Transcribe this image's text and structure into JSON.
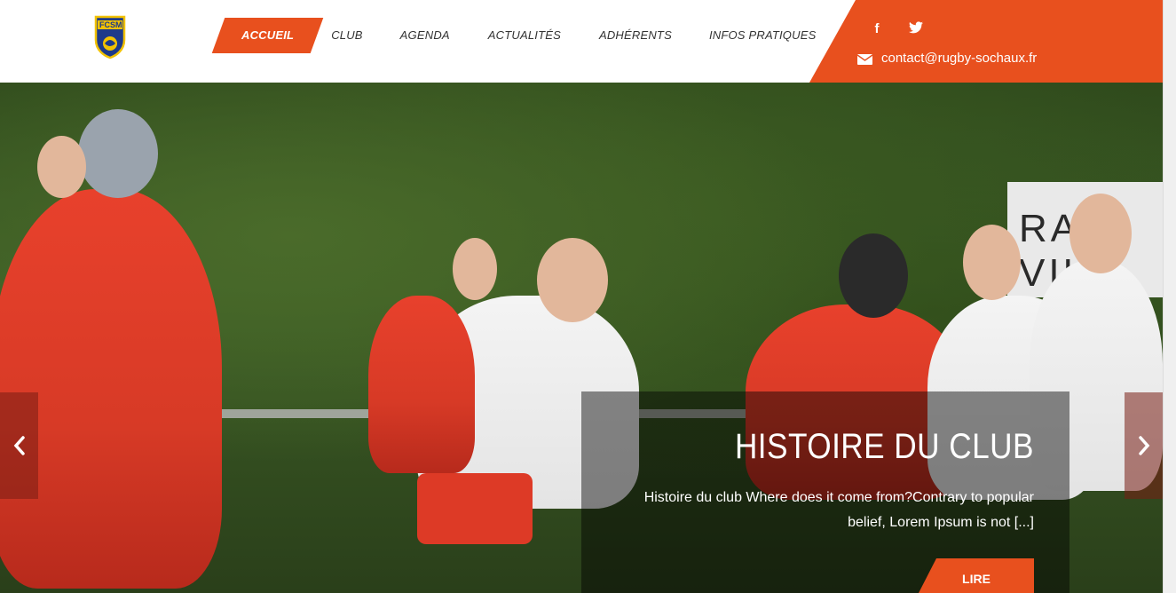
{
  "brand": {
    "logo_text": "FCSM",
    "accent": "#e8501e"
  },
  "nav": {
    "items": [
      {
        "label": "ACCUEIL",
        "active": true
      },
      {
        "label": "CLUB"
      },
      {
        "label": "AGENDA"
      },
      {
        "label": "ACTUALITÉS"
      },
      {
        "label": "ADHÉRENTS"
      },
      {
        "label": "INFOS PRATIQUES"
      }
    ]
  },
  "header": {
    "social": {
      "facebook": "f",
      "twitter": "twitter-icon"
    },
    "email": "contact@rugby-sochaux.fr"
  },
  "hero": {
    "banner_text": "RAM    VIL",
    "title": "HISTOIRE DU CLUB",
    "excerpt": "Histoire du club Where does it come from?Contrary to popular belief, Lorem Ipsum is not [...]",
    "button_label": "LIRE"
  }
}
